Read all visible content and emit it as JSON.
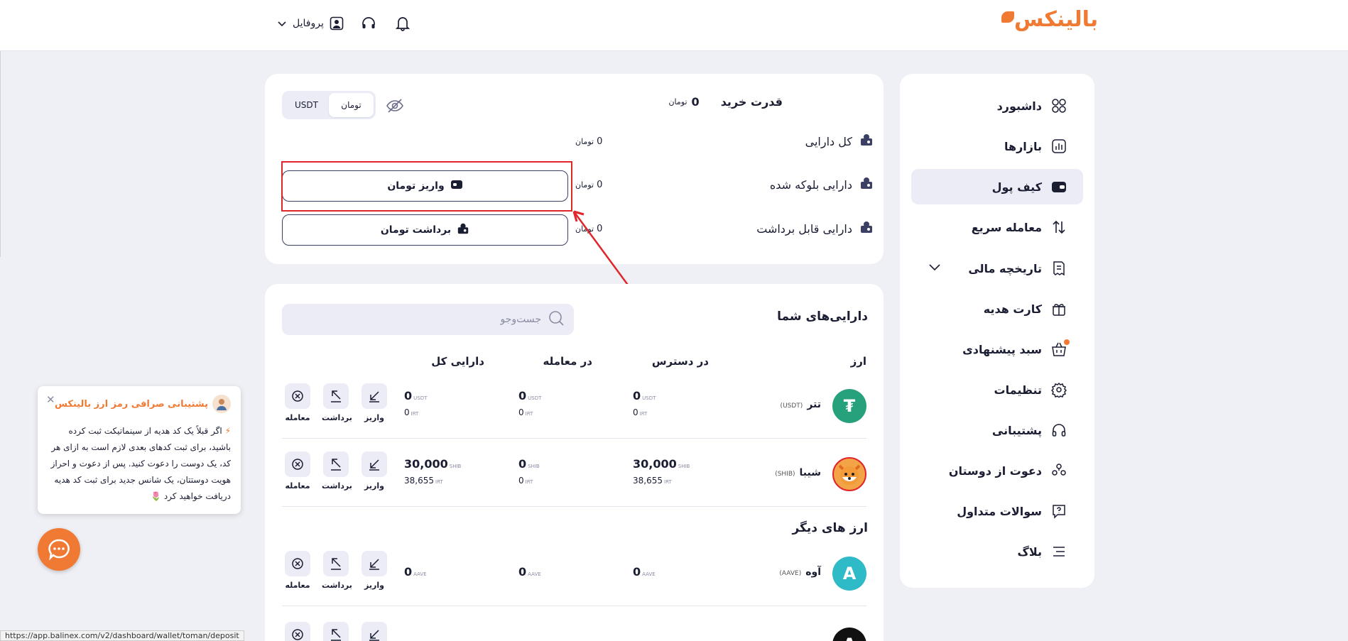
{
  "header": {
    "logo_text": "بالینکس",
    "profile_label": "پروفایل"
  },
  "sidebar": {
    "items": [
      {
        "label": "داشبورد"
      },
      {
        "label": "بازارها"
      },
      {
        "label": "کیف پول"
      },
      {
        "label": "معامله سریع"
      },
      {
        "label": "تاریخچه مالی"
      },
      {
        "label": "کارت هدیه"
      },
      {
        "label": "سبد پیشنهادی"
      },
      {
        "label": "تنظیمات"
      },
      {
        "label": "پشتیبانی"
      },
      {
        "label": "دعوت از دوستان"
      },
      {
        "label": "سوالات متداول"
      },
      {
        "label": "بلاگ"
      }
    ],
    "active_index": 2
  },
  "summary": {
    "buy_power_label": "قدرت خرید",
    "buy_power_value": "0",
    "currency_symbol": "تومان",
    "toggle_options": [
      "تومان",
      "USDT"
    ],
    "rows": [
      {
        "label": "کل دارایی",
        "value": "0"
      },
      {
        "label": "دارایی بلوکه شده",
        "value": "0"
      },
      {
        "label": "دارایی قابل برداشت",
        "value": "0"
      }
    ],
    "deposit_button": "واریز تومان",
    "withdraw_button": "برداشت تومان"
  },
  "assets": {
    "title": "دارایی‌های شما",
    "search_placeholder": "جست‌وجو",
    "columns": [
      "ارز",
      "در دسترس",
      "در معامله",
      "دارایی کل"
    ],
    "actions": [
      "واریز",
      "برداشت",
      "معامله"
    ],
    "coins": [
      {
        "name": "تتر",
        "symbol": "(USDT)",
        "unit": "USDT",
        "available": "0",
        "available_irt": "0",
        "in_trade": "0",
        "in_trade_irt": "0",
        "total": "0",
        "total_irt": "0"
      },
      {
        "name": "شیبا",
        "symbol": "(SHIB)",
        "unit": "SHIB",
        "available": "30,000",
        "available_irt": "38,655",
        "in_trade": "0",
        "in_trade_irt": "0",
        "total": "30,000",
        "total_irt": "38,655"
      }
    ],
    "other_title": "ارز های دیگر",
    "other_coins": [
      {
        "name": "آوه",
        "symbol": "(AAVE)",
        "unit": "AAVE",
        "available": "0",
        "in_trade": "0",
        "total": "0"
      }
    ],
    "irt_unit": "IRT"
  },
  "support_popup": {
    "title": "پشتیبانی صرافی رمز ارز بالینکس",
    "message": "اگر قبلاً یک کد هدیه از سینماتیکت ثبت کرده باشید، برای ثبت کدهای بعدی لازم است به ازای هر کد، یک دوست را دعوت کنید. پس از دعوت و احراز هویت دوستتان، یک شانس جدید برای ثبت کد هدیه دریافت خواهید کرد"
  },
  "status_bar": {
    "url": "https://app.balinex.com/v2/dashboard/wallet/toman/deposit"
  },
  "colors": {
    "brand": "#f07a33",
    "highlight": "#e0252b",
    "tether": "#26a17b",
    "aave": "#2ebac6"
  }
}
